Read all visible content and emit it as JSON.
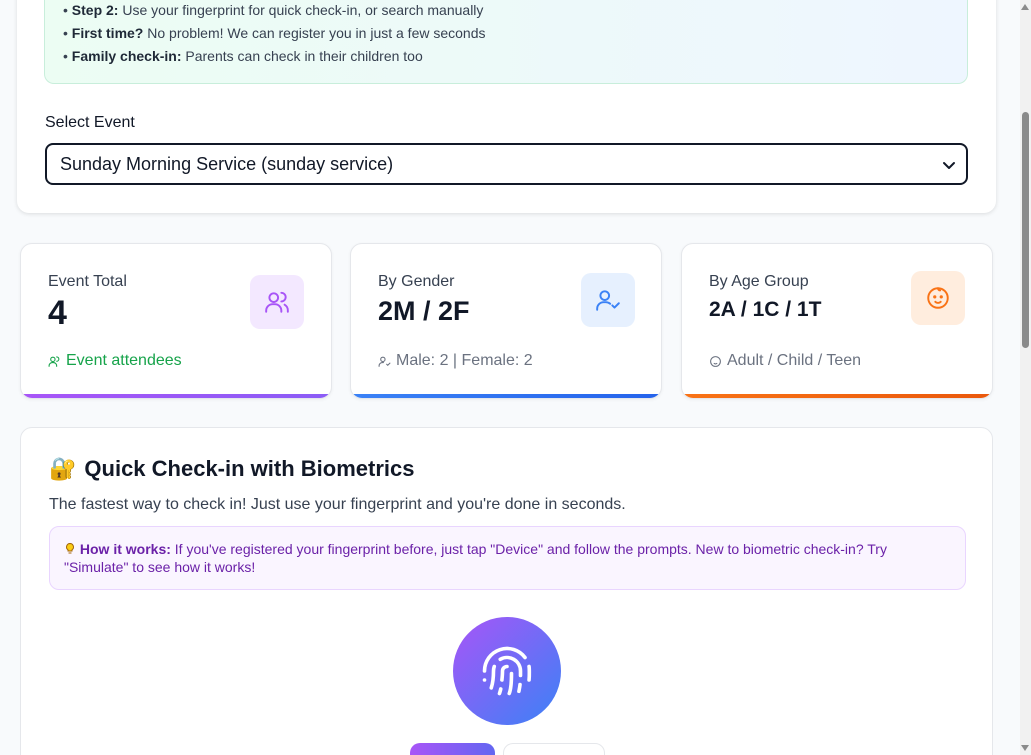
{
  "instructions": {
    "step2": {
      "bold": "Step 2:",
      "text": " Use your fingerprint for quick check-in, or search manually"
    },
    "first_time": {
      "bold": "First time?",
      "text": " No problem! We can register you in just a few seconds"
    },
    "family": {
      "bold": "Family check-in:",
      "text": " Parents can check in their children too"
    }
  },
  "event_select": {
    "label": "Select Event",
    "selected": "Sunday Morning Service (sunday service)"
  },
  "stats": {
    "event_total": {
      "label": "Event Total",
      "value": "4",
      "sub": "Event attendees",
      "accent": "#a855f7",
      "icon": "users-icon"
    },
    "by_gender": {
      "label": "By Gender",
      "value": "2M / 2F",
      "sub": "Male: 2 | Female: 2",
      "accent": "#3b82f6",
      "icon": "user-check-icon"
    },
    "by_age": {
      "label": "By Age Group",
      "value": "2A / 1C / 1T",
      "sub": "Adult / Child / Teen",
      "accent": "#f97316",
      "icon": "baby-icon"
    }
  },
  "biometric": {
    "emoji": "🔐",
    "title": "Quick Check-in with Biometrics",
    "description": "The fastest way to check in! Just use your fingerprint and you're done in seconds.",
    "howto_bold": "How it works:",
    "howto_text": " If you've registered your fingerprint before, just tap \"Device\" and follow the prompts. New to biometric check-in? Try \"Simulate\" to see how it works!",
    "icon": "fingerprint-icon"
  }
}
